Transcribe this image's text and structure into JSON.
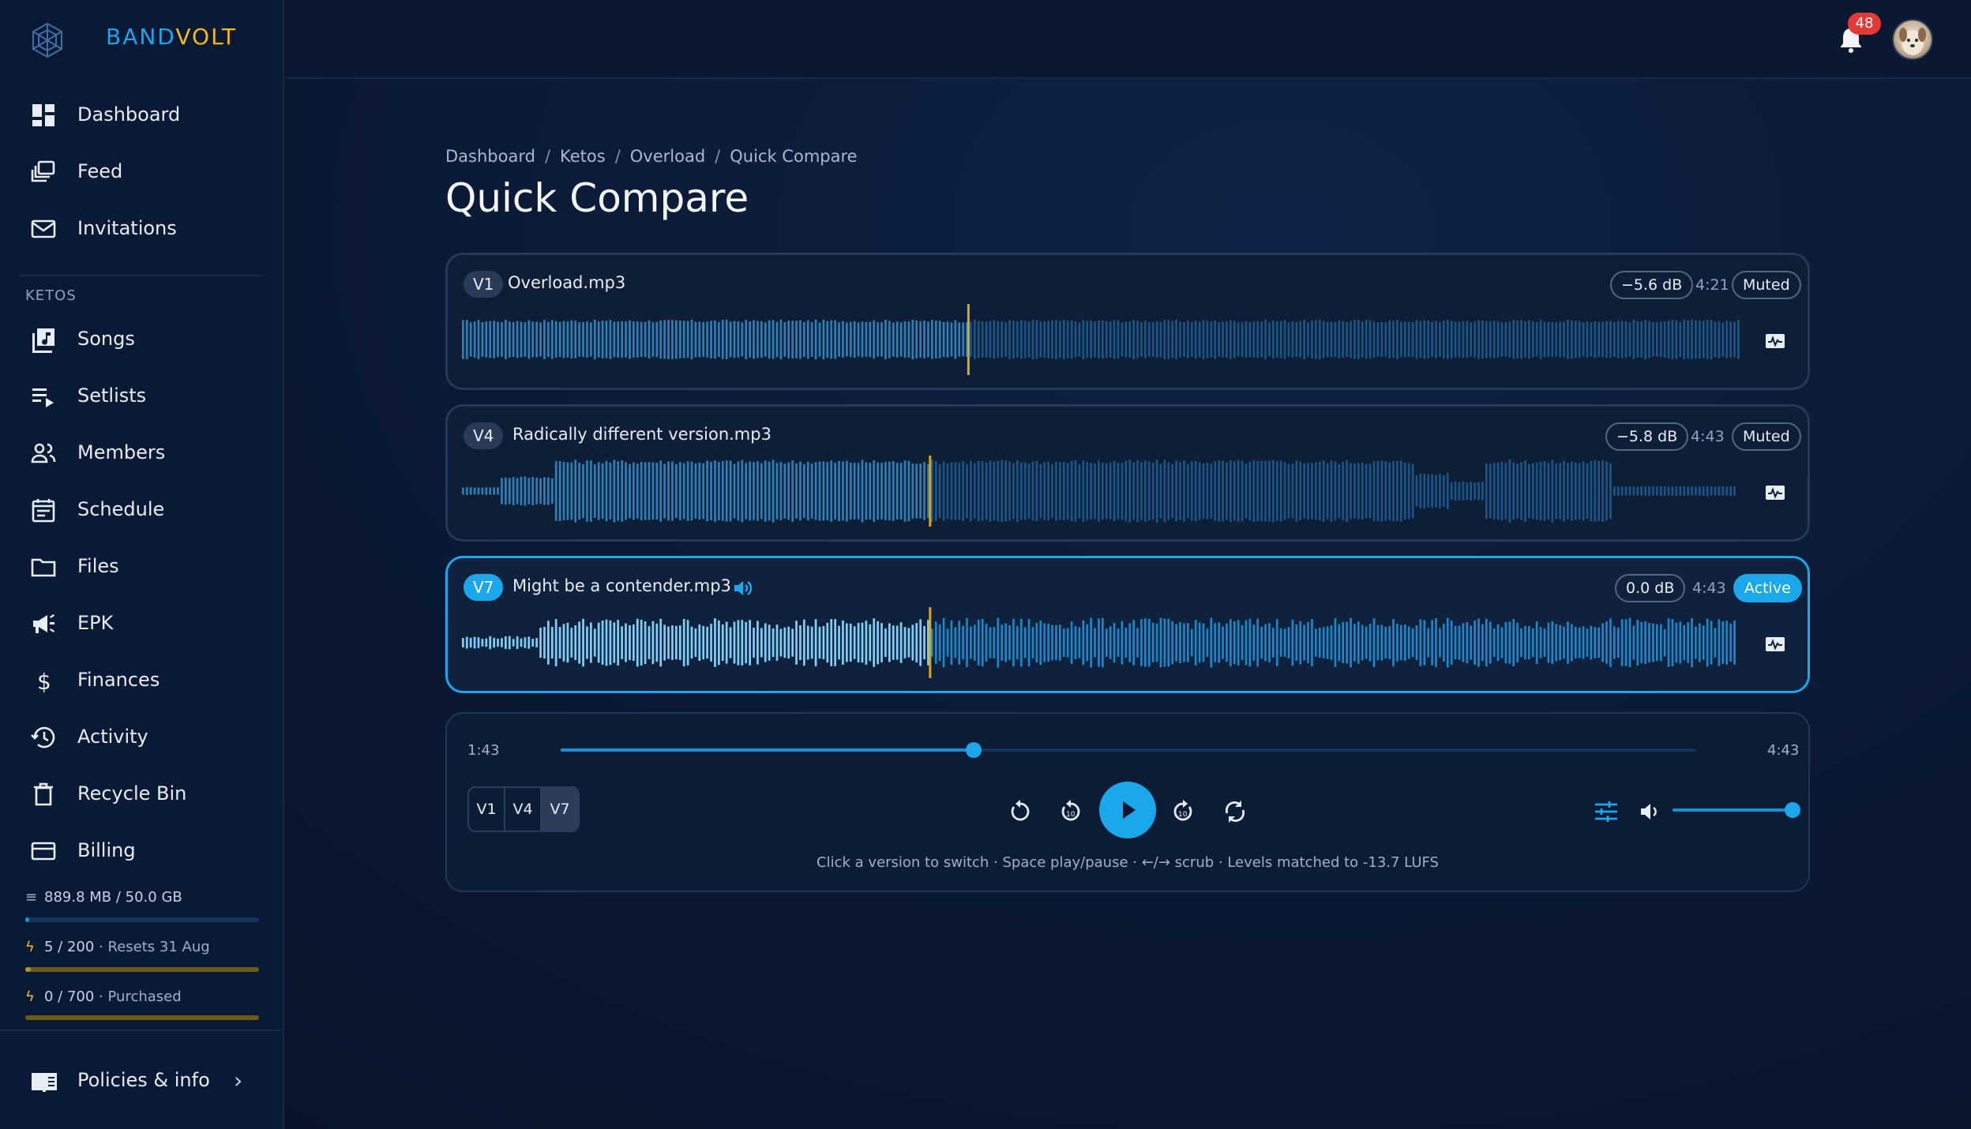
{
  "app": {
    "brand_first": "BAND",
    "brand_second": "VOLT",
    "accent": "#1aa7ec",
    "brand_yellow": "#f3b724"
  },
  "sidebar": {
    "top_items": [
      {
        "label": "Dashboard",
        "icon": "dashboard-icon"
      },
      {
        "label": "Feed",
        "icon": "feed-icon"
      },
      {
        "label": "Invitations",
        "icon": "mail-icon"
      }
    ],
    "section_label": "KETOS",
    "band_items": [
      {
        "label": "Songs",
        "icon": "music-library-icon"
      },
      {
        "label": "Setlists",
        "icon": "playlist-icon"
      },
      {
        "label": "Members",
        "icon": "people-icon"
      },
      {
        "label": "Schedule",
        "icon": "calendar-icon"
      },
      {
        "label": "Files",
        "icon": "folder-icon"
      },
      {
        "label": "EPK",
        "icon": "megaphone-icon"
      },
      {
        "label": "Finances",
        "icon": "dollar-icon"
      },
      {
        "label": "Activity",
        "icon": "history-icon"
      },
      {
        "label": "Recycle Bin",
        "icon": "trash-icon"
      },
      {
        "label": "Billing",
        "icon": "credit-card-icon"
      }
    ],
    "quotas": [
      {
        "icon": "storage-icon",
        "value": "889.8 MB / 50.0 GB",
        "extra": "",
        "fraction": 0.018,
        "color": "#1a8fd6"
      },
      {
        "icon": "bolt-icon",
        "value": "5 / 200",
        "extra": " · Resets 31 Aug",
        "fraction": 0.025,
        "color": "#b8941c"
      },
      {
        "icon": "bolt-icon",
        "value": "0 / 700",
        "extra": " · Purchased",
        "fraction": 0.0,
        "color": "#b8941c"
      }
    ],
    "policies_label": "Policies & info"
  },
  "topbar": {
    "notification_count": "48"
  },
  "breadcrumb": [
    "Dashboard",
    "Ketos",
    "Overload",
    "Quick Compare"
  ],
  "page_title": "Quick Compare",
  "tracks": [
    {
      "version": "V1",
      "name": "Overload.mp3",
      "gain": "−5.6 dB",
      "duration": "4:21",
      "state": "Muted",
      "active": false,
      "playhead_fraction": 0.395
    },
    {
      "version": "V4",
      "name": "Radically different version.mp3",
      "gain": "−5.8 dB",
      "duration": "4:43",
      "state": "Muted",
      "active": false,
      "playhead_fraction": 0.365
    },
    {
      "version": "V7",
      "name": "Might be a contender.mp3",
      "gain": "0.0 dB",
      "duration": "4:43",
      "state": "Active",
      "active": true,
      "playhead_fraction": 0.365
    }
  ],
  "player": {
    "current_time": "1:43",
    "total_time": "4:43",
    "progress_fraction": 0.364,
    "version_buttons": [
      "V1",
      "V4",
      "V7"
    ],
    "selected_version": "V7",
    "volume_fraction": 1.0,
    "hint": "Click a version to switch · Space play/pause · ←/→ scrub · Levels matched to -13.7 LUFS"
  }
}
